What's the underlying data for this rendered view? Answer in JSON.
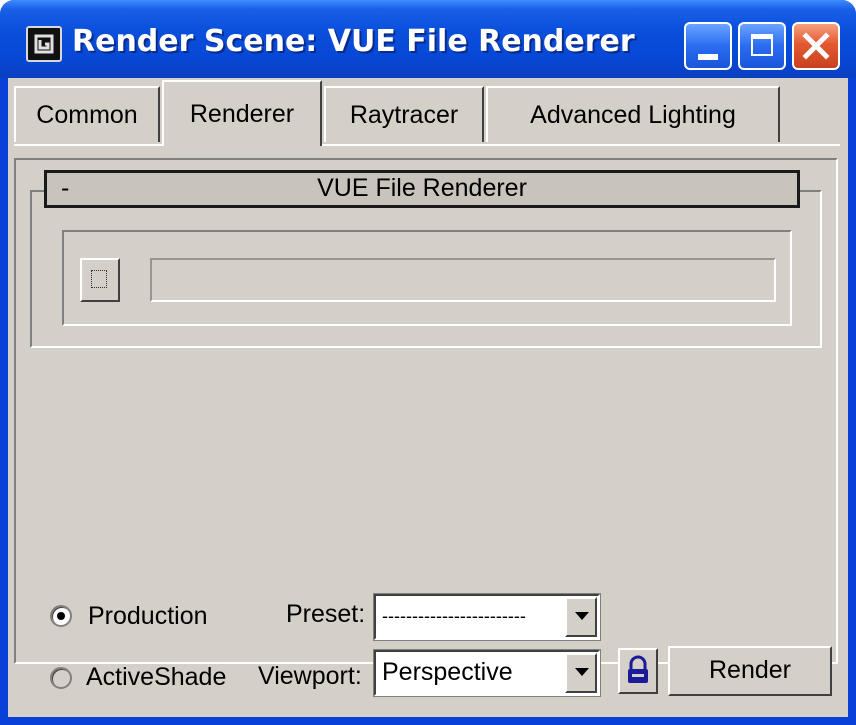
{
  "window": {
    "title": "Render Scene: VUE File Renderer",
    "icon": "3dsmax-app-icon",
    "controls": [
      "minimize-icon",
      "maximize-icon",
      "close-icon"
    ]
  },
  "tabs": [
    {
      "label": "Common",
      "active": false
    },
    {
      "label": "Renderer",
      "active": true
    },
    {
      "label": "Raytracer",
      "active": false
    },
    {
      "label": "Advanced Lighting",
      "active": false
    }
  ],
  "rollout": {
    "toggle": "-",
    "title": "VUE File Renderer",
    "browse_icon": "browse-file-icon",
    "path_value": ""
  },
  "bottom": {
    "mode_production": "Production",
    "mode_activeshade": "ActiveShade",
    "selected_mode": "Production",
    "preset_label": "Preset:",
    "preset_value": "------------------------",
    "viewport_label": "Viewport:",
    "viewport_value": "Perspective",
    "lock_icon": "lock-icon",
    "render_label": "Render"
  },
  "colors": {
    "titlebar": "#0a4fdc",
    "face": "#d4d0c8",
    "close": "#e35a32"
  }
}
